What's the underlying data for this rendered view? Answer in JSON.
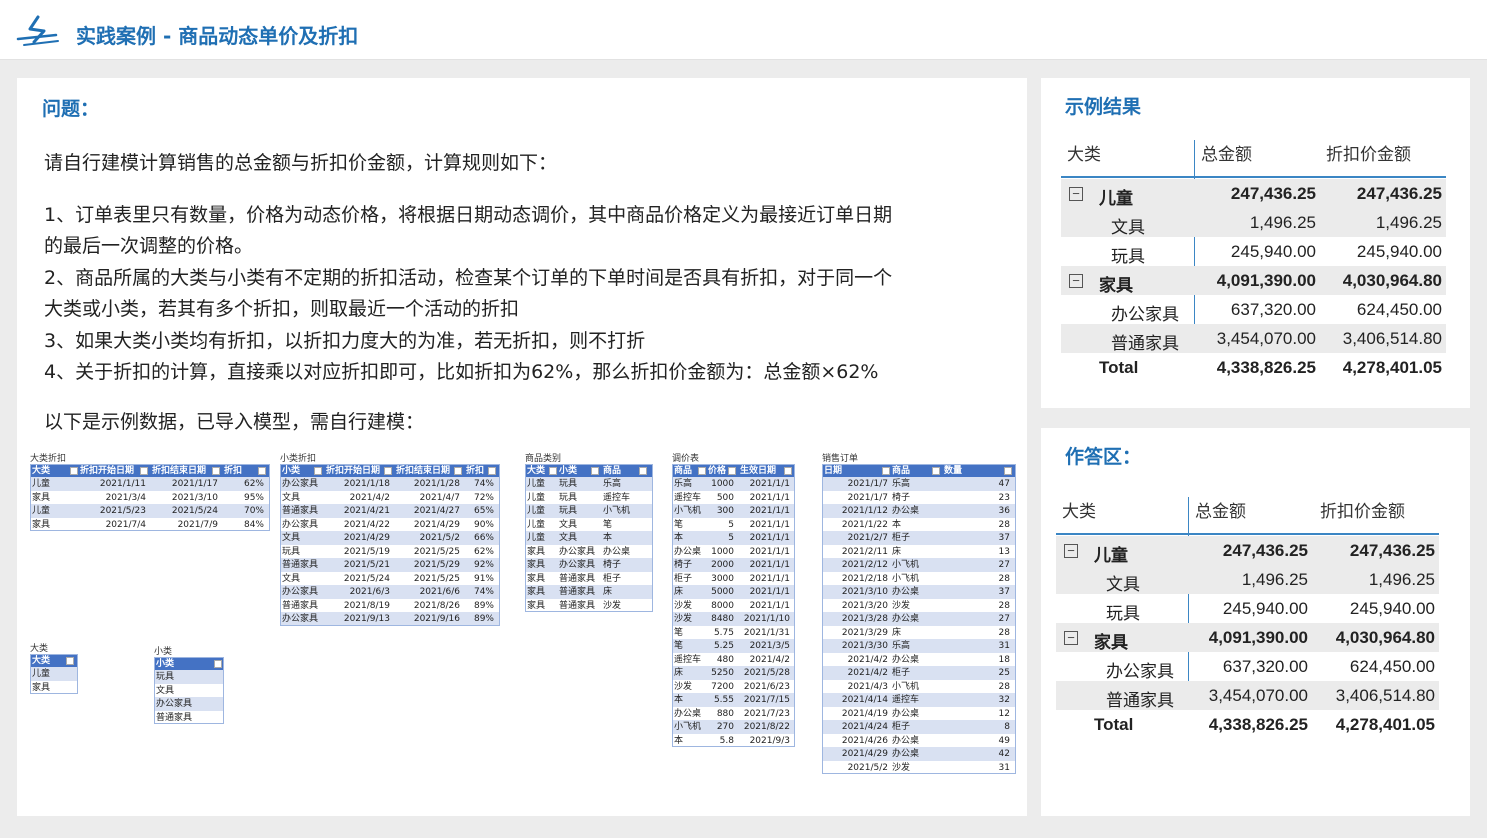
{
  "header": {
    "title": "实践案例 - 商品动态单价及折扣",
    "brand_color": "#1f6fb3",
    "logo_icon": "logo-icon"
  },
  "problem": {
    "heading": "问题：",
    "intro": "请自行建模计算销售的总金额与折扣价金额，计算规则如下：",
    "lines": [
      "1、订单表里只有数量，价格为动态价格，将根据日期动态调价，其中商品价格定义为最接近订单日期",
      "的最后一次调整的价格。",
      "2、商品所属的大类与小类有不定期的折扣活动，检查某个订单的下单时间是否具有折扣，对于同一个",
      "大类或小类，若其有多个折扣，则取最近一个活动的折扣",
      "3、如果大类小类均有折扣，以折扣力度大的为准，若无折扣，则不打折",
      "4、关于折扣的计算，直接乘以对应折扣即可，比如折扣为62%，那么折扣价金额为：总金额×62%"
    ],
    "data_note": "以下是示例数据，已导入模型，需自行建模："
  },
  "tables": {
    "dalei_discount": {
      "title": "大类折扣",
      "columns": [
        "大类",
        "折扣开始日期",
        "折扣结束日期",
        "折扣"
      ],
      "rows": [
        [
          "儿童",
          "2021/1/11",
          "2021/1/17",
          "62%"
        ],
        [
          "家具",
          "2021/3/4",
          "2021/3/10",
          "95%"
        ],
        [
          "儿童",
          "2021/5/23",
          "2021/5/24",
          "70%"
        ],
        [
          "家具",
          "2021/7/4",
          "2021/7/9",
          "84%"
        ]
      ]
    },
    "xiaolei_discount": {
      "title": "小类折扣",
      "columns": [
        "小类",
        "折扣开始日期",
        "折扣结束日期",
        "折扣"
      ],
      "rows": [
        [
          "办公家具",
          "2021/1/18",
          "2021/1/28",
          "74%"
        ],
        [
          "文具",
          "2021/4/2",
          "2021/4/7",
          "72%"
        ],
        [
          "普通家具",
          "2021/4/21",
          "2021/4/27",
          "65%"
        ],
        [
          "办公家具",
          "2021/4/22",
          "2021/4/29",
          "90%"
        ],
        [
          "文具",
          "2021/4/29",
          "2021/5/2",
          "66%"
        ],
        [
          "玩具",
          "2021/5/19",
          "2021/5/25",
          "62%"
        ],
        [
          "普通家具",
          "2021/5/21",
          "2021/5/29",
          "92%"
        ],
        [
          "文具",
          "2021/5/24",
          "2021/5/25",
          "91%"
        ],
        [
          "办公家具",
          "2021/6/3",
          "2021/6/6",
          "74%"
        ],
        [
          "普通家具",
          "2021/8/19",
          "2021/8/26",
          "89%"
        ],
        [
          "办公家具",
          "2021/9/13",
          "2021/9/16",
          "89%"
        ]
      ]
    },
    "category": {
      "title": "商品类别",
      "columns": [
        "大类",
        "小类",
        "商品"
      ],
      "rows": [
        [
          "儿童",
          "玩具",
          "乐高"
        ],
        [
          "儿童",
          "玩具",
          "遥控车"
        ],
        [
          "儿童",
          "玩具",
          "小飞机"
        ],
        [
          "儿童",
          "文具",
          "笔"
        ],
        [
          "儿童",
          "文具",
          "本"
        ],
        [
          "家具",
          "办公家具",
          "办公桌"
        ],
        [
          "家具",
          "办公家具",
          "椅子"
        ],
        [
          "家具",
          "普通家具",
          "柜子"
        ],
        [
          "家具",
          "普通家具",
          "床"
        ],
        [
          "家具",
          "普通家具",
          "沙发"
        ]
      ]
    },
    "price": {
      "title": "调价表",
      "columns": [
        "商品",
        "价格",
        "生效日期"
      ],
      "rows": [
        [
          "乐高",
          "1000",
          "2021/1/1"
        ],
        [
          "遥控车",
          "500",
          "2021/1/1"
        ],
        [
          "小飞机",
          "300",
          "2021/1/1"
        ],
        [
          "笔",
          "5",
          "2021/1/1"
        ],
        [
          "本",
          "5",
          "2021/1/1"
        ],
        [
          "办公桌",
          "1000",
          "2021/1/1"
        ],
        [
          "椅子",
          "2000",
          "2021/1/1"
        ],
        [
          "柜子",
          "3000",
          "2021/1/1"
        ],
        [
          "床",
          "5000",
          "2021/1/1"
        ],
        [
          "沙发",
          "8000",
          "2021/1/1"
        ],
        [
          "沙发",
          "8480",
          "2021/1/10"
        ],
        [
          "笔",
          "5.75",
          "2021/1/31"
        ],
        [
          "笔",
          "5.25",
          "2021/3/5"
        ],
        [
          "遥控车",
          "480",
          "2021/4/2"
        ],
        [
          "床",
          "5250",
          "2021/5/28"
        ],
        [
          "沙发",
          "7200",
          "2021/6/23"
        ],
        [
          "本",
          "5.55",
          "2021/7/15"
        ],
        [
          "办公桌",
          "880",
          "2021/7/23"
        ],
        [
          "小飞机",
          "270",
          "2021/8/22"
        ],
        [
          "本",
          "5.8",
          "2021/9/3"
        ]
      ]
    },
    "orders": {
      "title": "销售订单",
      "columns": [
        "日期",
        "商品",
        "数量"
      ],
      "rows": [
        [
          "2021/1/7",
          "乐高",
          "47"
        ],
        [
          "2021/1/7",
          "椅子",
          "23"
        ],
        [
          "2021/1/12",
          "办公桌",
          "36"
        ],
        [
          "2021/1/22",
          "本",
          "28"
        ],
        [
          "2021/2/7",
          "柜子",
          "37"
        ],
        [
          "2021/2/11",
          "床",
          "13"
        ],
        [
          "2021/2/12",
          "小飞机",
          "27"
        ],
        [
          "2021/2/18",
          "小飞机",
          "28"
        ],
        [
          "2021/3/10",
          "办公桌",
          "37"
        ],
        [
          "2021/3/20",
          "沙发",
          "28"
        ],
        [
          "2021/3/28",
          "办公桌",
          "27"
        ],
        [
          "2021/3/29",
          "床",
          "28"
        ],
        [
          "2021/3/30",
          "乐高",
          "31"
        ],
        [
          "2021/4/2",
          "办公桌",
          "18"
        ],
        [
          "2021/4/2",
          "柜子",
          "25"
        ],
        [
          "2021/4/3",
          "小飞机",
          "28"
        ],
        [
          "2021/4/14",
          "遥控车",
          "32"
        ],
        [
          "2021/4/19",
          "办公桌",
          "12"
        ],
        [
          "2021/4/24",
          "柜子",
          "8"
        ],
        [
          "2021/4/26",
          "办公桌",
          "49"
        ],
        [
          "2021/4/29",
          "办公桌",
          "42"
        ],
        [
          "2021/5/2",
          "沙发",
          "31"
        ]
      ]
    },
    "dalei": {
      "title": "大类",
      "columns": [
        "大类"
      ],
      "rows": [
        [
          "儿童"
        ],
        [
          "家具"
        ]
      ]
    },
    "xiaolei": {
      "title": "小类",
      "columns": [
        "小类"
      ],
      "rows": [
        [
          "玩具"
        ],
        [
          "文具"
        ],
        [
          "办公家具"
        ],
        [
          "普通家具"
        ]
      ]
    }
  },
  "result": {
    "heading": "示例结果",
    "columns": [
      "大类",
      "总金额",
      "折扣价金额"
    ],
    "rows": [
      {
        "label": "儿童",
        "total": "247,436.25",
        "discount": "247,436.25",
        "level": 0,
        "expander": "⊟"
      },
      {
        "label": "文具",
        "total": "1,496.25",
        "discount": "1,496.25",
        "level": 1
      },
      {
        "label": "玩具",
        "total": "245,940.00",
        "discount": "245,940.00",
        "level": 1
      },
      {
        "label": "家具",
        "total": "4,091,390.00",
        "discount": "4,030,964.80",
        "level": 0,
        "expander": "⊟"
      },
      {
        "label": "办公家具",
        "total": "637,320.00",
        "discount": "624,450.00",
        "level": 1
      },
      {
        "label": "普通家具",
        "total": "3,454,070.00",
        "discount": "3,406,514.80",
        "level": 1
      },
      {
        "label": "Total",
        "total": "4,338,826.25",
        "discount": "4,278,401.05",
        "level": 2
      }
    ]
  },
  "answer": {
    "heading": "作答区：",
    "columns": [
      "大类",
      "总金额",
      "折扣价金额"
    ],
    "rows": [
      {
        "label": "儿童",
        "total": "247,436.25",
        "discount": "247,436.25",
        "level": 0,
        "expander": "⊟"
      },
      {
        "label": "文具",
        "total": "1,496.25",
        "discount": "1,496.25",
        "level": 1
      },
      {
        "label": "玩具",
        "total": "245,940.00",
        "discount": "245,940.00",
        "level": 1
      },
      {
        "label": "家具",
        "total": "4,091,390.00",
        "discount": "4,030,964.80",
        "level": 0,
        "expander": "⊟"
      },
      {
        "label": "办公家具",
        "total": "637,320.00",
        "discount": "624,450.00",
        "level": 1
      },
      {
        "label": "普通家具",
        "total": "3,454,070.00",
        "discount": "3,406,514.80",
        "level": 1
      },
      {
        "label": "Total",
        "total": "4,338,826.25",
        "discount": "4,278,401.05",
        "level": 2
      }
    ]
  }
}
